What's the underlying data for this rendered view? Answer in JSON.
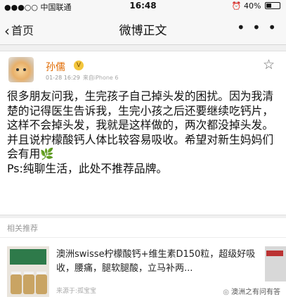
{
  "status_bar": {
    "carrier": "●●●○○ 中国联通",
    "wifi_icon": "wifi-icon",
    "time": "16:48",
    "alarm_icon": "alarm-icon",
    "battery_text": "40%",
    "battery_level": 0.4
  },
  "nav": {
    "back_label": "首页",
    "title": "微博正文",
    "more_label": "• • •"
  },
  "post": {
    "username": "孙儒",
    "vip_badge": "V",
    "date": "01-28 16:29",
    "source": "来自iPhone 6",
    "body": "很多朋友问我，生完孩子自己掉头发的困扰。因为我清楚的记得医生告诉我，生完小孩之后还要继续吃钙片，这样不会掉头发，我就是这样做的，两次都没掉头发。并且说柠檬酸钙人体比较容易吸收。希望对新生妈妈们会有用",
    "emoji": "🌿",
    "footer_line": "Ps:纯聊生活，此处不推荐品牌。"
  },
  "related": {
    "title": "相关推荐",
    "item_text": "澳洲swisse柠檬酸钙+维生素D150粒，超级好吸收，腰痛，腿软腿酸，立马补两...",
    "item_source": "来源于:孤宝宝"
  },
  "watermark": {
    "text": "澳洲之有问有答",
    "icon": "wechat-icon"
  },
  "colors": {
    "username": "#e06a00",
    "background": "#f0f0f0"
  }
}
